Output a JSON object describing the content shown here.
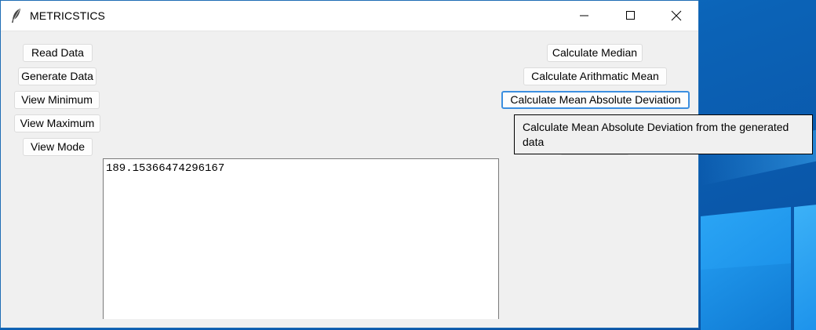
{
  "window": {
    "title": "METRICSTICS",
    "app_icon": "feather-icon",
    "controls": [
      "minimize-icon",
      "maximize-icon",
      "close-icon"
    ]
  },
  "left_buttons": {
    "read_data": "Read Data",
    "generate_data": "Generate Data",
    "view_minimum": "View Minimum",
    "view_maximum": "View Maximum",
    "view_mode": "View Mode"
  },
  "right_buttons": {
    "median": "Calculate Median",
    "arithmetic_mean": "Calculate Arithmatic Mean",
    "mean_absolute_deviation": "Calculate Mean Absolute Deviation"
  },
  "output": {
    "value": "189.15366474296167"
  },
  "tooltip": {
    "text": "Calculate Mean Absolute Deviation from the generated data"
  },
  "colors": {
    "accent_focus": "#3c8fe0",
    "desktop_blue": "#0b63b7"
  }
}
